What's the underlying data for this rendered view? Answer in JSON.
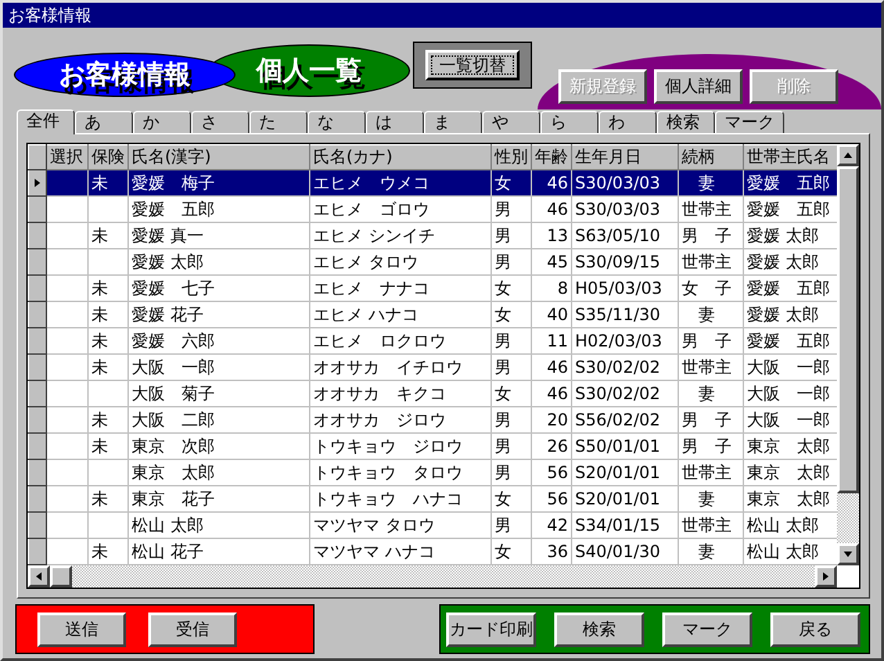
{
  "window": {
    "title": "お客様情報"
  },
  "header": {
    "title": "お客様情報",
    "subtitle": "個人一覧",
    "toggle_button": "一覧切替",
    "actions": [
      {
        "label": "新規登録",
        "disabled": true
      },
      {
        "label": "個人詳細",
        "disabled": false
      },
      {
        "label": "削除",
        "disabled": true
      }
    ]
  },
  "tabs": [
    {
      "label": "全件",
      "selected": true
    },
    {
      "label": "あ",
      "selected": false
    },
    {
      "label": "か",
      "selected": false
    },
    {
      "label": "さ",
      "selected": false
    },
    {
      "label": "た",
      "selected": false
    },
    {
      "label": "な",
      "selected": false
    },
    {
      "label": "は",
      "selected": false
    },
    {
      "label": "ま",
      "selected": false
    },
    {
      "label": "や",
      "selected": false
    },
    {
      "label": "ら",
      "selected": false
    },
    {
      "label": "わ",
      "selected": false
    },
    {
      "label": "検索",
      "selected": false
    },
    {
      "label": "マーク",
      "selected": false
    }
  ],
  "table": {
    "columns": [
      "選択",
      "保険",
      "氏名(漢字)",
      "氏名(カナ)",
      "性別",
      "年齢",
      "生年月日",
      "続柄",
      "世帯主氏名"
    ],
    "rows": [
      {
        "selected": true,
        "insurance": "未",
        "name": "愛媛　梅子",
        "kana": "エヒメ　ウメコ",
        "sex": "女",
        "age": "46",
        "birth": "S30/03/03",
        "relation": "　妻",
        "head": "愛媛　五郎"
      },
      {
        "selected": false,
        "name": "愛媛　五郎",
        "kana": "エヒメ　ゴロウ",
        "sex": "男",
        "age": "46",
        "birth": "S30/03/03",
        "relation": "世帯主",
        "head": "愛媛　五郎"
      },
      {
        "selected": false,
        "insurance": "未",
        "name": "愛媛 真一",
        "kana": "エヒメ シンイチ",
        "sex": "男",
        "age": "13",
        "birth": "S63/05/10",
        "relation": "男　子",
        "head": "愛媛 太郎"
      },
      {
        "selected": false,
        "name": "愛媛 太郎",
        "kana": "エヒメ タロウ",
        "sex": "男",
        "age": "45",
        "birth": "S30/09/15",
        "relation": "世帯主",
        "head": "愛媛 太郎"
      },
      {
        "selected": false,
        "insurance": "未",
        "name": "愛媛　七子",
        "kana": "エヒメ　ナナコ",
        "sex": "女",
        "age": "8",
        "birth": "H05/03/03",
        "relation": "女　子",
        "head": "愛媛　五郎"
      },
      {
        "selected": false,
        "insurance": "未",
        "name": "愛媛 花子",
        "kana": "エヒメ ハナコ",
        "sex": "女",
        "age": "40",
        "birth": "S35/11/30",
        "relation": "　妻",
        "head": "愛媛 太郎"
      },
      {
        "selected": false,
        "insurance": "未",
        "name": "愛媛　六郎",
        "kana": "エヒメ　ロクロウ",
        "sex": "男",
        "age": "11",
        "birth": "H02/03/03",
        "relation": "男　子",
        "head": "愛媛　五郎"
      },
      {
        "selected": false,
        "insurance": "未",
        "name": "大阪　一郎",
        "kana": "オオサカ　イチロウ",
        "sex": "男",
        "age": "46",
        "birth": "S30/02/02",
        "relation": "世帯主",
        "head": "大阪　一郎"
      },
      {
        "selected": false,
        "name": "大阪　菊子",
        "kana": "オオサカ　キクコ",
        "sex": "女",
        "age": "46",
        "birth": "S30/02/02",
        "relation": "　妻",
        "head": "大阪　一郎"
      },
      {
        "selected": false,
        "insurance": "未",
        "name": "大阪　二郎",
        "kana": "オオサカ　ジロウ",
        "sex": "男",
        "age": "20",
        "birth": "S56/02/02",
        "relation": "男　子",
        "head": "大阪　一郎"
      },
      {
        "selected": false,
        "insurance": "未",
        "name": "東京　次郎",
        "kana": "トウキョウ　ジロウ",
        "sex": "男",
        "age": "26",
        "birth": "S50/01/01",
        "relation": "男　子",
        "head": "東京　太郎"
      },
      {
        "selected": false,
        "name": "東京　太郎",
        "kana": "トウキョウ　タロウ",
        "sex": "男",
        "age": "56",
        "birth": "S20/01/01",
        "relation": "世帯主",
        "head": "東京　太郎"
      },
      {
        "selected": false,
        "insurance": "未",
        "name": "東京　花子",
        "kana": "トウキョウ　ハナコ",
        "sex": "女",
        "age": "56",
        "birth": "S20/01/01",
        "relation": "　妻",
        "head": "東京　太郎"
      },
      {
        "selected": false,
        "name": "松山 太郎",
        "kana": "マツヤマ タロウ",
        "sex": "男",
        "age": "42",
        "birth": "S34/01/15",
        "relation": "世帯主",
        "head": "松山 太郎"
      },
      {
        "selected": false,
        "insurance": "未",
        "name": "松山 花子",
        "kana": "マツヤマ ハナコ",
        "sex": "女",
        "age": "36",
        "birth": "S40/01/30",
        "relation": "　妻",
        "head": "松山 太郎"
      }
    ]
  },
  "footer": {
    "left_buttons": [
      "送信",
      "受信"
    ],
    "right_buttons": [
      "カード印刷",
      "検索",
      "マーク",
      "戻る"
    ]
  }
}
